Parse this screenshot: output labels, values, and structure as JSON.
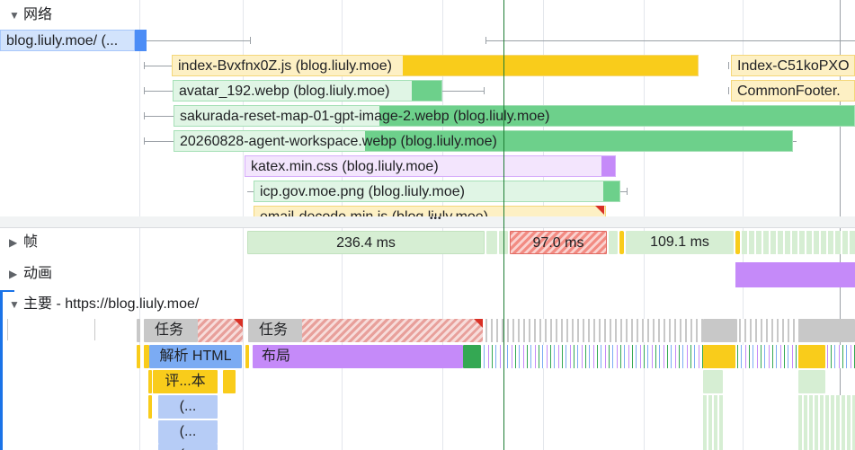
{
  "network": {
    "title": "网络",
    "requests": [
      {
        "label": "blog.liuly.moe/ (..."
      },
      {
        "label": "index-Bvxfnx0Z.js (blog.liuly.moe)"
      },
      {
        "label": "Index-C51koPXO"
      },
      {
        "label": "avatar_192.webp (blog.liuly.moe)"
      },
      {
        "label": "CommonFooter."
      },
      {
        "label": "sakurada-reset-map-01-gpt-image-2.webp (blog.liuly.moe)"
      },
      {
        "label": "20260828-agent-workspace.webp (blog.liuly.moe)"
      },
      {
        "label": "katex.min.css (blog.liuly.moe)"
      },
      {
        "label": "icp.gov.moe.png (blog.liuly.moe)"
      },
      {
        "label": "email-decode.min.js (blog.liuly.moe)"
      }
    ],
    "resize_handle": "•••"
  },
  "frames": {
    "title": "帧",
    "items": [
      {
        "label": "236.4 ms"
      },
      {
        "label": "97.0 ms"
      },
      {
        "label": "109.1 ms"
      }
    ]
  },
  "animations": {
    "title": "动画"
  },
  "main": {
    "title": "主要 - https://blog.liuly.moe/",
    "task1": "任务",
    "task2": "任务",
    "parse_html": "解析 HTML",
    "layout": "布局",
    "evaluate": "评...本",
    "sub1": "(...",
    "sub2": "(...",
    "sub3": "(..."
  },
  "colors": {
    "script": "#f9cc1b",
    "image": "#6dd08b",
    "css": "#c58af9",
    "document": "#4c8df6",
    "task": "#c8c8c8",
    "frame_ok": "#d6eed3",
    "accent_line": "#1e7e34"
  }
}
